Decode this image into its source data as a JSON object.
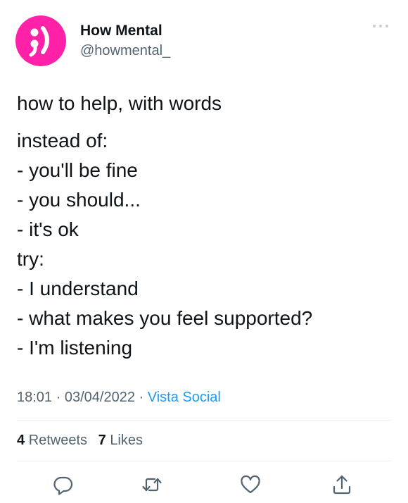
{
  "tweet": {
    "author": {
      "display_name": "How Mental",
      "handle": "@howmental_",
      "avatar_color": "#ff21a8"
    },
    "text_lines": [
      "how to help, with words",
      "instead of:",
      "- you'll be fine",
      "- you should...",
      "- it's ok",
      "try:",
      "- I understand",
      "- what makes you feel supported?",
      "- I'm listening"
    ],
    "meta": {
      "time": "18:01",
      "date": "03/04/2022",
      "source": "Vista Social",
      "separator": " · "
    },
    "stats": {
      "retweets_count": "4",
      "retweets_label": "Retweets",
      "likes_count": "7",
      "likes_label": "Likes"
    },
    "actions": [
      "reply-icon",
      "retweet-icon",
      "like-icon",
      "share-icon"
    ],
    "colors": {
      "text": "#0f1419",
      "secondary": "#536471",
      "link": "#1d9bf0",
      "divider": "#eff3f4"
    }
  }
}
